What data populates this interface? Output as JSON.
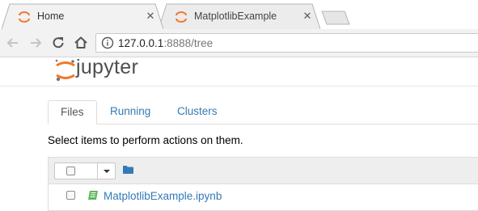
{
  "browser": {
    "tabs": [
      {
        "title": "Home",
        "active": true,
        "favicon": "jupyter-favicon-icon"
      },
      {
        "title": "MatplotlibExample",
        "active": false,
        "favicon": "jupyter-favicon-icon"
      }
    ],
    "new_tab_icon": "new-tab-icon",
    "close_icon": "close-icon",
    "url_host": "127.0.0.1",
    "url_path": ":8888/tree",
    "nav_icons": [
      "back-arrow-icon",
      "forward-arrow-icon",
      "reload-icon",
      "home-icon",
      "info-icon"
    ]
  },
  "jupyter": {
    "logo_text": "jupyter",
    "logo_colors": {
      "orange": "#f37726",
      "gray": "#767677"
    }
  },
  "nav_tabs": [
    {
      "label": "Files",
      "active": true
    },
    {
      "label": "Running",
      "active": false
    },
    {
      "label": "Clusters",
      "active": false
    }
  ],
  "hint": "Select items to perform actions on them.",
  "file_list": {
    "header_icons": [
      "select-all-checkbox",
      "dropdown-caret-icon",
      "folder-icon"
    ],
    "items": [
      {
        "name": "MatplotlibExample.ipynb",
        "icon": "notebook-icon",
        "icon_color": "#5cb85c"
      }
    ]
  },
  "colors": {
    "link": "#337ab7",
    "jupyter_orange": "#f37726"
  }
}
